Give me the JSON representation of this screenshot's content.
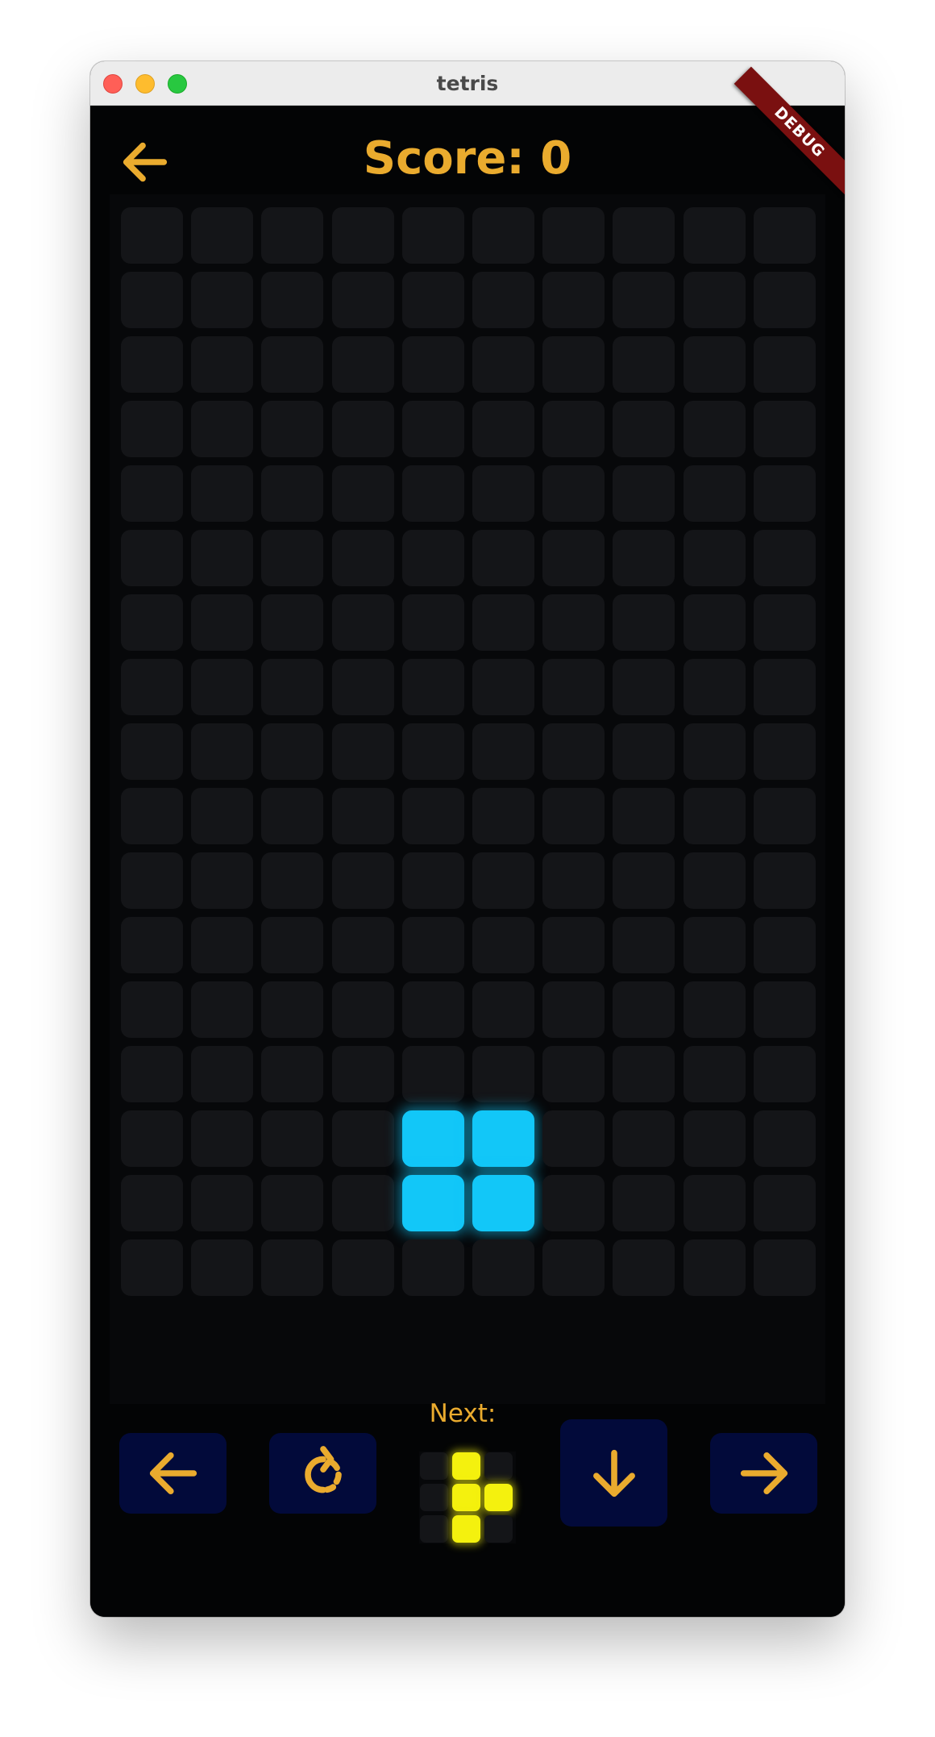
{
  "window": {
    "title": "tetris",
    "traffic_lights": [
      "close",
      "minimize",
      "zoom"
    ]
  },
  "header": {
    "back_icon": "arrow-left-icon",
    "score_text": "Score: 0",
    "debug_banner": "DEBUG"
  },
  "colors": {
    "accent": "#eaab2e",
    "board_background": "#07080a",
    "empty_cell": "#141518",
    "active_piece": "#12c7f8",
    "next_piece": "#f4f10e",
    "control_button": "#020a3a"
  },
  "board": {
    "columns": 10,
    "rows": 17,
    "filled_cells": [
      {
        "row": 14,
        "col": 4
      },
      {
        "row": 14,
        "col": 5
      },
      {
        "row": 15,
        "col": 4
      },
      {
        "row": 15,
        "col": 5
      }
    ]
  },
  "controls": {
    "left_icon": "arrow-left-icon",
    "rotate_icon": "rotate-icon",
    "down_icon": "arrow-down-icon",
    "right_icon": "arrow-right-icon",
    "next_label": "Next:"
  },
  "next_piece": {
    "columns": 3,
    "rows": 3,
    "filled_cells": [
      {
        "row": 0,
        "col": 1
      },
      {
        "row": 1,
        "col": 1
      },
      {
        "row": 1,
        "col": 2
      },
      {
        "row": 2,
        "col": 1
      }
    ]
  }
}
